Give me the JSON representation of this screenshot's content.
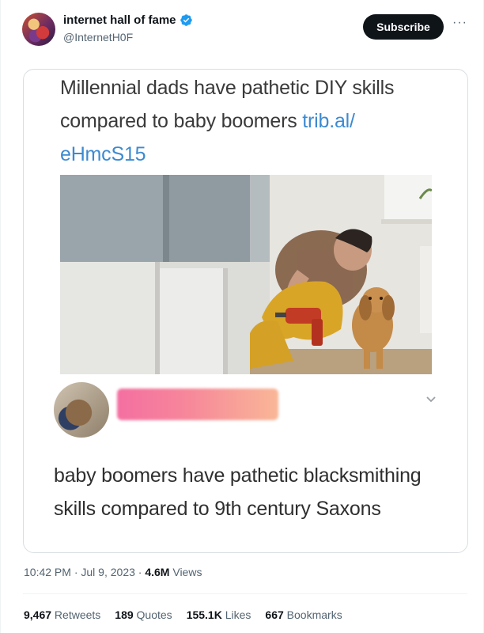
{
  "author": {
    "display_name": "internet hall of fame",
    "handle": "@InternetH0F",
    "avatar_icon": "avatar-collage",
    "verified_icon": "verified-badge-icon",
    "verified_color": "#1d9bf0"
  },
  "actions": {
    "subscribe_label": "Subscribe",
    "more_label": "···"
  },
  "post": {
    "headline_text": "Millennial dads have pathetic DIY skills compared to baby boomers ",
    "headline_link": "trib.al/ eHmcS15",
    "reply_text": "baby boomers have pathetic blacksmithing skills compared to 9th century Saxons"
  },
  "meta": {
    "time": "10:42 PM",
    "sep1": " · ",
    "date": "Jul 9, 2023",
    "sep2": " · ",
    "views_count": "4.6M",
    "views_label": " Views"
  },
  "stats": {
    "retweets_count": "9,467",
    "retweets_label": " Retweets",
    "quotes_count": "189",
    "quotes_label": " Quotes",
    "likes_count": "155.1K",
    "likes_label": " Likes",
    "bookmarks_count": "667",
    "bookmarks_label": " Bookmarks"
  },
  "colors": {
    "link": "#3d8ad1",
    "button_bg": "#0f1419",
    "muted_text": "#536471"
  }
}
